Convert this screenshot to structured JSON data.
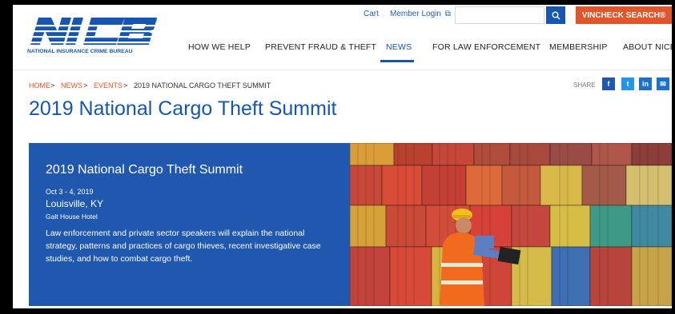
{
  "header": {
    "logo_text": "NICB",
    "logo_tagline": "NATIONAL INSURANCE CRIME BUREAU",
    "utility": {
      "cart": "Cart",
      "member_login": "Member Login"
    },
    "search_placeholder": "",
    "vincheck_label": "VINCHECK SEARCH®"
  },
  "nav": {
    "items": [
      {
        "label": "HOW WE HELP"
      },
      {
        "label": "PREVENT FRAUD & THEFT"
      },
      {
        "label": "NEWS"
      },
      {
        "label": "FOR LAW ENFORCEMENT"
      },
      {
        "label": "MEMBERSHIP"
      },
      {
        "label": "ABOUT NICB"
      }
    ],
    "active": "NEWS"
  },
  "breadcrumb": [
    {
      "label": "HOME"
    },
    {
      "label": "NEWS"
    },
    {
      "label": "EVENTS"
    },
    {
      "label": "2019 NATIONAL CARGO THEFT SUMMIT"
    }
  ],
  "breadcrumb_sep": ">",
  "share": {
    "label": "SHARE",
    "icons": [
      {
        "name": "facebook-icon",
        "glyph": "f",
        "color": "#1f58ae"
      },
      {
        "name": "twitter-icon",
        "glyph": "t",
        "color": "#2196e8"
      },
      {
        "name": "linkedin-icon",
        "glyph": "in",
        "color": "#1a73c7"
      },
      {
        "name": "email-icon",
        "glyph": "✉",
        "color": "#1a73c7"
      }
    ]
  },
  "page_title": "2019 National Cargo Theft Summit",
  "hero": {
    "title": "2019 National Cargo Theft Summit",
    "dates": "Oct 3 - 4, 2019",
    "city": "Louisville, KY",
    "venue": "Galt House Hotel",
    "description": "Law enforcement and private sector speakers will explain the national strategy, patterns and practices of cargo thieves, recent investigative case studies, and how to combat cargo theft."
  },
  "colors": {
    "brand_blue": "#1557b0",
    "accent_orange": "#e2542a",
    "hero_blue": "#1f58ae"
  }
}
